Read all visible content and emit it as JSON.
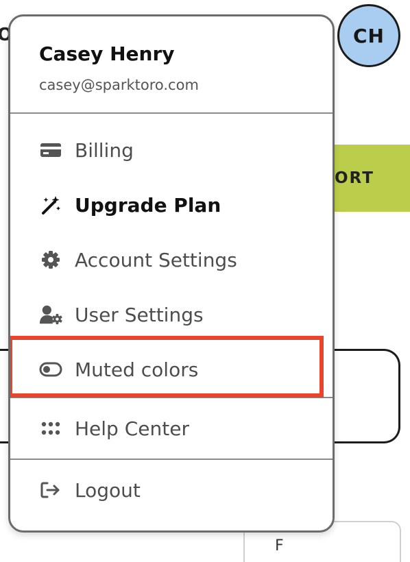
{
  "background": {
    "left_fragment": "O",
    "avatar_initials": "CH",
    "button_fragment": "ORT",
    "bottom_card_fragment": "F"
  },
  "user": {
    "name": "Casey Henry",
    "email": "casey@sparktoro.com"
  },
  "menu": {
    "items": [
      {
        "label": "Billing",
        "icon": "credit-card-icon"
      },
      {
        "label": "Upgrade Plan",
        "icon": "magic-wand-icon"
      },
      {
        "label": "Account Settings",
        "icon": "gear-icon"
      },
      {
        "label": "User Settings",
        "icon": "user-gear-icon"
      },
      {
        "label": "Muted colors",
        "icon": "toggle-icon"
      },
      {
        "label": "Help Center",
        "icon": "grid-dots-icon"
      },
      {
        "label": "Logout",
        "icon": "logout-icon"
      }
    ]
  },
  "colors": {
    "avatar": "#a9cdf0",
    "accent_button": "#bccd4b",
    "highlight": "#e8452c"
  }
}
